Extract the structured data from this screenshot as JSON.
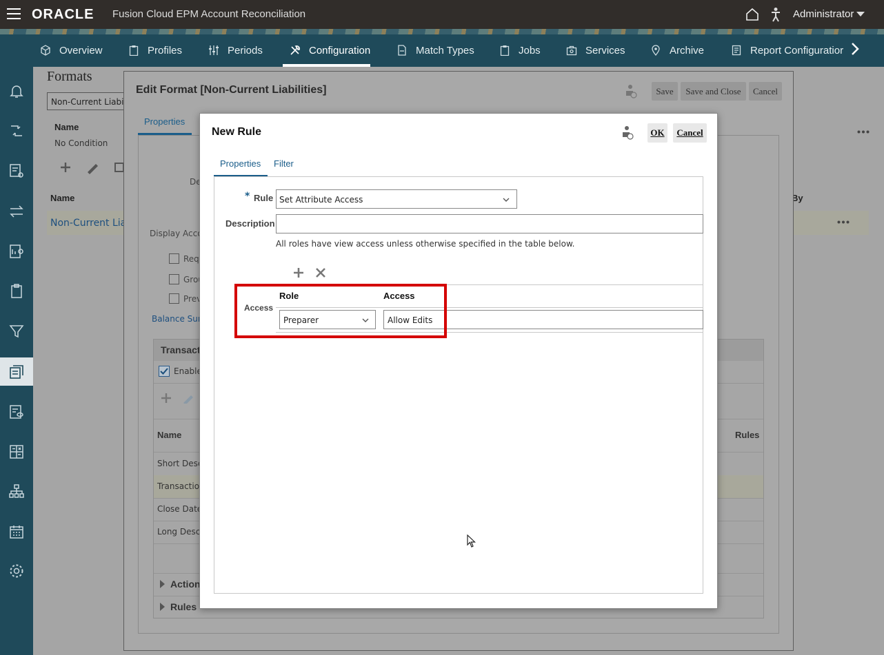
{
  "header": {
    "logo": "ORACLE",
    "app_title": "Fusion Cloud EPM Account Reconciliation",
    "user": "Administrator"
  },
  "nav": {
    "items": [
      "Overview",
      "Profiles",
      "Periods",
      "Configuration",
      "Match Types",
      "Jobs",
      "Services",
      "Archive",
      "Report Configuratior"
    ],
    "active": "Configuration"
  },
  "page": {
    "title": "Formats",
    "select_value": "Non-Current Liabiliti",
    "filter_name_header": "Name",
    "filter_no_condition": "No Condition",
    "table_name_header": "Name",
    "table_by_header": "By",
    "row_name": "Non-Current Liab"
  },
  "edit_format": {
    "title": "Edit Format [Non-Current Liabilities]",
    "save": "Save",
    "save_close": "Save and Close",
    "cancel": "Cancel",
    "tab_properties": "Properties",
    "desc_label": "De",
    "display_access": "Display Acco",
    "checkboxes": [
      "Requ",
      "Grou",
      "Prev"
    ],
    "balance_link": "Balance Sum",
    "section_title": "Transact",
    "enable_label": "Enable",
    "name_header": "Name",
    "rules_header": "Rules",
    "rows": [
      "Short Descr",
      "Transaction",
      "Close Date",
      "Long Descr"
    ],
    "actions": "Action",
    "rules": "Rules"
  },
  "new_rule": {
    "title": "New Rule",
    "ok": "OK",
    "cancel": "Cancel",
    "tab_properties": "Properties",
    "tab_filter": "Filter",
    "rule_label": "Rule",
    "rule_required": "*",
    "rule_value": "Set Attribute Access",
    "description_label": "Description",
    "description_value": "",
    "note": "All roles have view access unless otherwise specified in the table below.",
    "access_label": "Access",
    "col_role": "Role",
    "col_access": "Access",
    "role_value": "Preparer",
    "access_value": "Allow Edits"
  },
  "colors": {
    "topbar": "#312d2a",
    "nav": "#1f4a5a",
    "accent": "#1a5d8a",
    "highlight_box": "#d40000"
  }
}
